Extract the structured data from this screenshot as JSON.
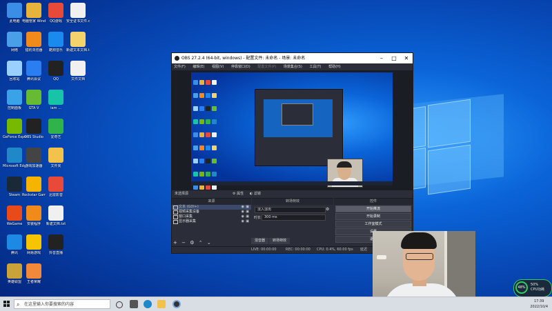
{
  "desktop": {
    "icons": [
      {
        "label": "此电脑",
        "color": "#3a8ee6"
      },
      {
        "label": "电脑管家 Windows",
        "color": "#e6b43a"
      },
      {
        "label": "QQ游戏",
        "color": "#e84a3a"
      },
      {
        "label": "安全证书文件.crt",
        "color": "#f0f0f0"
      },
      {
        "label": "网络",
        "color": "#4aa0e8"
      },
      {
        "label": "猎豹浏览器",
        "color": "#f08a1a"
      },
      {
        "label": "酷狗音乐",
        "color": "#1a8aee"
      },
      {
        "label": "新建文本文档.txt",
        "color": "#f3d36b"
      },
      {
        "label": "回收站",
        "color": "#9ad0ff"
      },
      {
        "label": "腾讯会议",
        "color": "#2a7ef0"
      },
      {
        "label": "QQ",
        "color": "#222"
      },
      {
        "label": "文件文档",
        "color": "#f0f0f0"
      },
      {
        "label": "控制面板",
        "color": "#3aa3e8"
      },
      {
        "label": "GTA V",
        "color": "#6b3"
      },
      {
        "label": "iam ...",
        "color": "#18c4a8"
      },
      {
        "label": "",
        "color": "#000"
      },
      {
        "label": "GeForce Experience",
        "color": "#76b900"
      },
      {
        "label": "OBS Studio",
        "color": "#222"
      },
      {
        "label": "爱奇艺",
        "color": "#2fb34a"
      },
      {
        "label": "",
        "color": "#000"
      },
      {
        "label": "Microsoft Edge",
        "color": "#1e88c8"
      },
      {
        "label": "游戏加速器",
        "color": "#444"
      },
      {
        "label": "文件夹",
        "color": "#f3c24a"
      },
      {
        "label": "",
        "color": "#000"
      },
      {
        "label": "Steam",
        "color": "#1b2838"
      },
      {
        "label": "Rockstar Games",
        "color": "#f6b400"
      },
      {
        "label": "迅雷影音",
        "color": "#e84a3a"
      },
      {
        "label": "",
        "color": "#000"
      },
      {
        "label": "WeGame",
        "color": "#e84a1a"
      },
      {
        "label": "安装程序",
        "color": "#f08a1a"
      },
      {
        "label": "新建文档.txt",
        "color": "#f0f0f0"
      },
      {
        "label": "",
        "color": "#000"
      },
      {
        "label": "腾讯",
        "color": "#1e88e5"
      },
      {
        "label": "网易游戏",
        "color": "#f6c400"
      },
      {
        "label": "抖音直播",
        "color": "#222"
      },
      {
        "label": "",
        "color": "#000"
      },
      {
        "label": "英雄联盟",
        "color": "#c9a23a"
      },
      {
        "label": "王者荣耀",
        "color": "#f08a3a"
      }
    ]
  },
  "obs": {
    "title": "OBS 27.2.4 (64-bit, windows) - 配置文件: 未命名 - 场景: 未命名",
    "menu": [
      "文件(F)",
      "编辑(E)",
      "视图(V)",
      "停靠窗口(D)",
      "配置文件(P)",
      "场景集合(S)",
      "工具(T)",
      "帮助(H)"
    ],
    "scenebar_left": "未选择源",
    "scenebar_props": "属性",
    "scenebar_filters": "滤镜",
    "panels": {
      "sources_title": "来源",
      "transitions_title": "转场特效",
      "controls_title": "控件"
    },
    "sources": [
      {
        "name": "文本 (GDI+)",
        "selected": true
      },
      {
        "name": "视频采集设备",
        "selected": false
      },
      {
        "name": "窗口采集",
        "selected": false
      },
      {
        "name": "显示器采集",
        "selected": false
      }
    ],
    "transition": {
      "type": "淡入淡出",
      "duration_label": "时长",
      "duration": "300 ms"
    },
    "controls": [
      "开始推流",
      "开始录制",
      "工作室模式",
      "设置",
      "退出"
    ],
    "tabs": [
      "混音器",
      "转场特效"
    ],
    "status": {
      "live": "LIVE: 00:00:00",
      "rec": "REC: 00:00:00",
      "cpu": "CPU: 0.4%, 60.00 fps",
      "extra": "延迟"
    }
  },
  "taskbar": {
    "search_placeholder": "在这里输入你要搜索的内容",
    "clock_time": "17:39",
    "clock_date": "2022/10/4",
    "cpu_percent": "48%",
    "cpu_label1": "50%",
    "cpu_label2": "CPU功耗"
  },
  "colors": {
    "obs_bg": "#2b2e38",
    "desktop_blue": "#0a64d8"
  }
}
